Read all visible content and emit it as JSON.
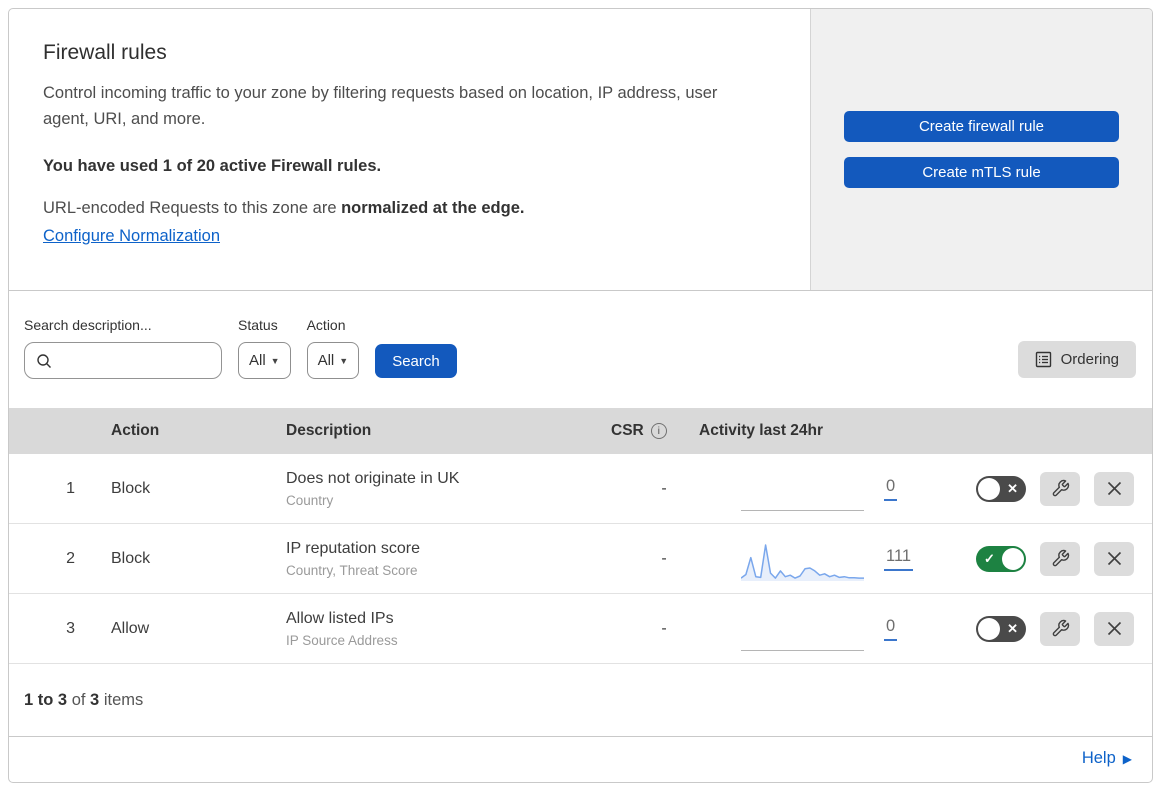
{
  "header": {
    "title": "Firewall rules",
    "description": "Control incoming traffic to your zone by filtering requests based on location, IP address, user agent, URI, and more.",
    "usage": "You have used 1 of 20 active Firewall rules.",
    "normalization_prefix": "URL-encoded Requests to this zone are ",
    "normalization_bold": "normalized at the edge.",
    "normalization_link": "Configure Normalization",
    "create_firewall_button": "Create firewall rule",
    "create_mtls_button": "Create mTLS rule"
  },
  "filters": {
    "search_label": "Search description...",
    "search_value": "",
    "status_label": "Status",
    "status_value": "All",
    "action_label": "Action",
    "action_value": "All",
    "search_button": "Search",
    "ordering_button": "Ordering"
  },
  "table": {
    "columns": {
      "action": "Action",
      "description": "Description",
      "csr": "CSR",
      "csr_info_icon": "i",
      "activity": "Activity last 24hr"
    },
    "rows": [
      {
        "index": "1",
        "action": "Block",
        "description": "Does not originate in UK",
        "fields": "Country",
        "csr": "-",
        "activity_count": "0",
        "enabled": false,
        "toggle_glyph": "✕"
      },
      {
        "index": "2",
        "action": "Block",
        "description": "IP reputation score",
        "fields": "Country, Threat Score",
        "csr": "-",
        "activity_count": "111",
        "enabled": true,
        "toggle_glyph": "✓",
        "sparkline": [
          8,
          18,
          65,
          12,
          10,
          100,
          22,
          8,
          28,
          12,
          16,
          8,
          14,
          34,
          36,
          28,
          16,
          20,
          12,
          16,
          10,
          12,
          9,
          9,
          8,
          8
        ]
      },
      {
        "index": "3",
        "action": "Allow",
        "description": "Allow listed IPs",
        "fields": "IP Source Address",
        "csr": "-",
        "activity_count": "0",
        "enabled": false,
        "toggle_glyph": "✕"
      }
    ]
  },
  "footer": {
    "range": "1 to 3",
    "of_text": " of ",
    "total": "3",
    "items_text": " items",
    "help_label": "Help"
  },
  "colors": {
    "accent_blue": "#1359bd",
    "link_blue": "#0d62c9",
    "toggle_on_green": "#1d8242",
    "toggle_off_gray": "#4a4a4a",
    "sparkline_blue": "#7aa7ec",
    "table_header_gray": "#d9d9d9",
    "panel_gray": "#f0f0f0"
  }
}
